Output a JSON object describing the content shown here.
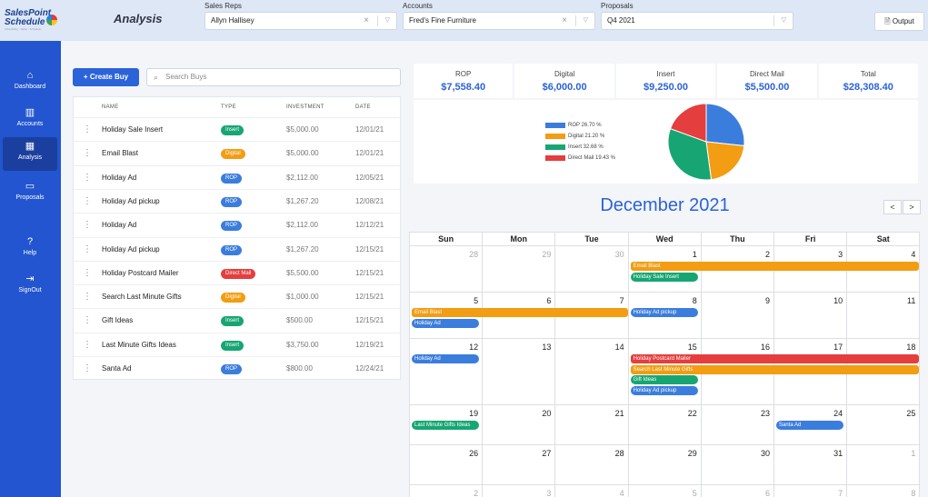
{
  "app": {
    "logo_line1": "SalesPoint",
    "logo_line2": "Schedule",
    "logo_tagline": "Advertising · Sales · Schedule",
    "page_title": "Analysis"
  },
  "filters": [
    {
      "label": "Sales Reps",
      "value": "Allyn Hallisey"
    },
    {
      "label": "Accounts",
      "value": "Fred's Fine Furniture"
    },
    {
      "label": "Proposals",
      "value": "Q4 2021"
    }
  ],
  "output_label": "Output",
  "sidebar": {
    "items": [
      {
        "label": "Dashboard",
        "icon": "home-icon",
        "active": false
      },
      {
        "label": "Accounts",
        "icon": "building-icon",
        "active": false
      },
      {
        "label": "Analysis",
        "icon": "calendar-icon",
        "active": true
      },
      {
        "label": "Proposals",
        "icon": "presentation-icon",
        "active": false
      },
      {
        "label": "Help",
        "icon": "help-icon",
        "active": false
      },
      {
        "label": "SignOut",
        "icon": "signout-icon",
        "active": false
      }
    ]
  },
  "buys": {
    "create_label": "Create Buy",
    "search_placeholder": "Search Buys",
    "columns": [
      "NAME",
      "TYPE",
      "INVESTMENT",
      "DATE"
    ],
    "rows": [
      {
        "name": "Holiday Sale Insert",
        "type": "Insert",
        "investment": "$5,000.00",
        "date": "12/01/21"
      },
      {
        "name": "Email Blast",
        "type": "Digital",
        "investment": "$5,000.00",
        "date": "12/01/21"
      },
      {
        "name": "Holiday Ad",
        "type": "ROP",
        "investment": "$2,112.00",
        "date": "12/05/21"
      },
      {
        "name": "Holiday Ad pickup",
        "type": "ROP",
        "investment": "$1,267.20",
        "date": "12/08/21"
      },
      {
        "name": "Holiday Ad",
        "type": "ROP",
        "investment": "$2,112.00",
        "date": "12/12/21"
      },
      {
        "name": "Holiday Ad pickup",
        "type": "ROP",
        "investment": "$1,267.20",
        "date": "12/15/21"
      },
      {
        "name": "Holiday Postcard Mailer",
        "type": "Direct Mail",
        "investment": "$5,500.00",
        "date": "12/15/21"
      },
      {
        "name": "Search Last Minute Gifts",
        "type": "Digital",
        "investment": "$1,000.00",
        "date": "12/15/21"
      },
      {
        "name": "Gift Ideas",
        "type": "Insert",
        "investment": "$500.00",
        "date": "12/15/21"
      },
      {
        "name": "Last Minute Gifts Ideas",
        "type": "Insert",
        "investment": "$3,750.00",
        "date": "12/19/21"
      },
      {
        "name": "Santa Ad",
        "type": "ROP",
        "investment": "$800.00",
        "date": "12/24/21"
      }
    ]
  },
  "type_colors": {
    "ROP": "#3b7ddd",
    "Digital": "#f29d12",
    "Insert": "#17a673",
    "Direct Mail": "#e53e3e"
  },
  "totals": [
    {
      "label": "ROP",
      "value": "$7,558.40"
    },
    {
      "label": "Digital",
      "value": "$6,000.00"
    },
    {
      "label": "Insert",
      "value": "$9,250.00"
    },
    {
      "label": "Direct Mail",
      "value": "$5,500.00"
    },
    {
      "label": "Total",
      "value": "$28,308.40"
    }
  ],
  "chart_data": {
    "type": "pie",
    "title": "",
    "slices": [
      {
        "legend": "ROP 26.70 %",
        "value": 26.7,
        "color": "#3b7ddd"
      },
      {
        "legend": "Digital 21.20 %",
        "value": 21.2,
        "color": "#f29d12"
      },
      {
        "legend": "Insert 32.68 %",
        "value": 32.68,
        "color": "#17a673"
      },
      {
        "legend": "Direct Mail 19.43 %",
        "value": 19.43,
        "color": "#e53e3e"
      }
    ],
    "legend_position": "left"
  },
  "calendar": {
    "title": "December 2021",
    "prev": "<",
    "next": ">",
    "weekdays": [
      "Sun",
      "Mon",
      "Tue",
      "Wed",
      "Thu",
      "Fri",
      "Sat"
    ],
    "weeks": [
      [
        {
          "d": "28",
          "o": true
        },
        {
          "d": "29",
          "o": true
        },
        {
          "d": "30",
          "o": true
        },
        {
          "d": "1"
        },
        {
          "d": "2"
        },
        {
          "d": "3"
        },
        {
          "d": "4"
        }
      ],
      [
        {
          "d": "5"
        },
        {
          "d": "6"
        },
        {
          "d": "7"
        },
        {
          "d": "8"
        },
        {
          "d": "9"
        },
        {
          "d": "10"
        },
        {
          "d": "11"
        }
      ],
      [
        {
          "d": "12"
        },
        {
          "d": "13"
        },
        {
          "d": "14"
        },
        {
          "d": "15"
        },
        {
          "d": "16"
        },
        {
          "d": "17"
        },
        {
          "d": "18"
        }
      ],
      [
        {
          "d": "19"
        },
        {
          "d": "20"
        },
        {
          "d": "21"
        },
        {
          "d": "22"
        },
        {
          "d": "23"
        },
        {
          "d": "24"
        },
        {
          "d": "25"
        }
      ],
      [
        {
          "d": "26"
        },
        {
          "d": "27"
        },
        {
          "d": "28"
        },
        {
          "d": "29"
        },
        {
          "d": "30"
        },
        {
          "d": "31"
        },
        {
          "d": "1",
          "o": true
        }
      ],
      [
        {
          "d": "2",
          "o": true
        },
        {
          "d": "3",
          "o": true
        },
        {
          "d": "4",
          "o": true
        },
        {
          "d": "5",
          "o": true
        },
        {
          "d": "6",
          "o": true
        },
        {
          "d": "7",
          "o": true
        },
        {
          "d": "8",
          "o": true
        }
      ]
    ],
    "events": [
      {
        "label": "Email Blast",
        "type": "Digital",
        "week": 0,
        "start": 3,
        "span": 4,
        "bar": true
      },
      {
        "label": "Holiday Sale Insert",
        "type": "Insert",
        "week": 0,
        "start": 3,
        "span": 1
      },
      {
        "label": "Email Blast",
        "type": "Digital",
        "week": 1,
        "start": 0,
        "span": 3,
        "bar": true
      },
      {
        "label": "Holiday Ad",
        "type": "ROP",
        "week": 1,
        "start": 0,
        "span": 1
      },
      {
        "label": "Holiday Ad pickup",
        "type": "ROP",
        "week": 1,
        "start": 3,
        "span": 1,
        "slot": 0
      },
      {
        "label": "Holiday Ad",
        "type": "ROP",
        "week": 2,
        "start": 0,
        "span": 1
      },
      {
        "label": "Holiday Postcard Mailer",
        "type": "Direct Mail",
        "week": 2,
        "start": 3,
        "span": 4,
        "bar": true
      },
      {
        "label": "Search Last Minute Gifts",
        "type": "Digital",
        "week": 2,
        "start": 3,
        "span": 4,
        "bar": true
      },
      {
        "label": "Gift Ideas",
        "type": "Insert",
        "week": 2,
        "start": 3,
        "span": 1
      },
      {
        "label": "Holiday Ad pickup",
        "type": "ROP",
        "week": 2,
        "start": 3,
        "span": 1
      },
      {
        "label": "Last Minute Gifts Ideas",
        "type": "Insert",
        "week": 3,
        "start": 0,
        "span": 1
      },
      {
        "label": "Santa Ad",
        "type": "ROP",
        "week": 3,
        "start": 5,
        "span": 1
      }
    ]
  }
}
